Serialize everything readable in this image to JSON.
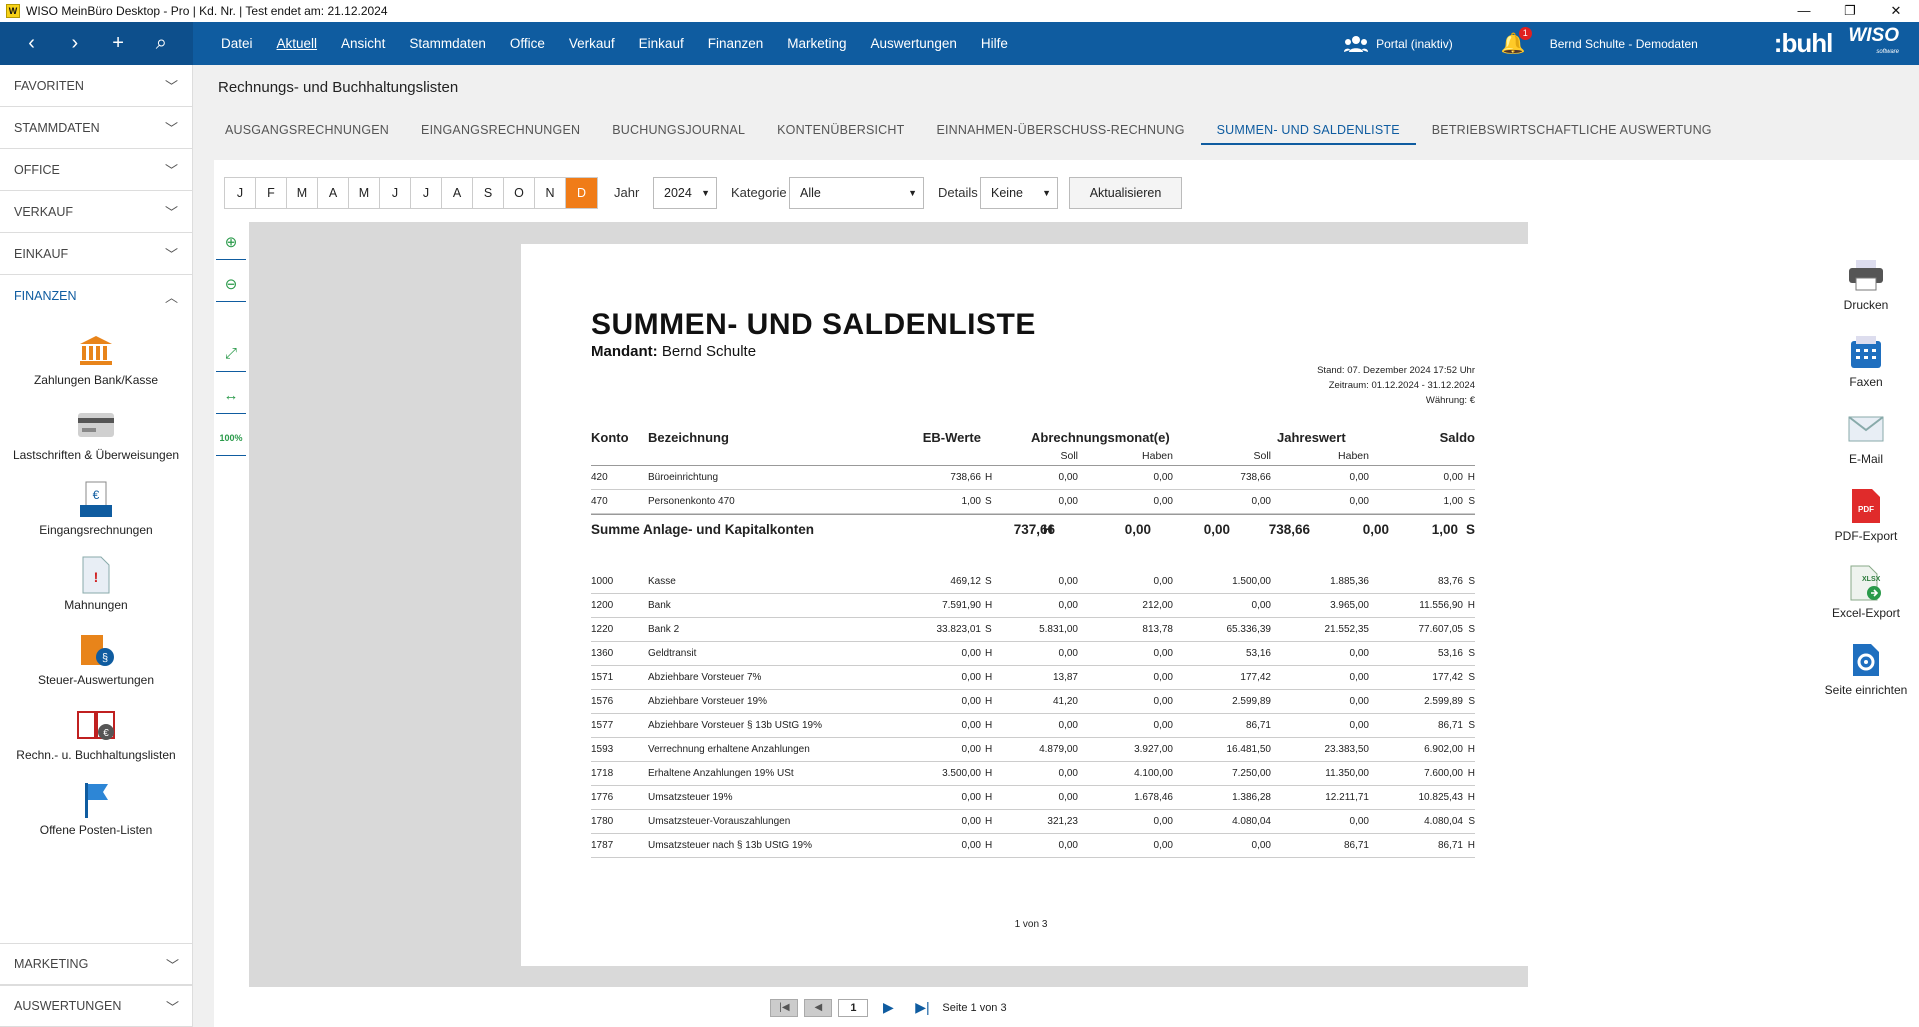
{
  "titlebar": {
    "text": "WISO MeinBüro Desktop - Pro | Kd. Nr.  | Test endet am: 21.12.2024",
    "minimize": "—",
    "maximize": "❐",
    "close": "✕"
  },
  "menubar": {
    "items": [
      "Datei",
      "Aktuell",
      "Ansicht",
      "Stammdaten",
      "Office",
      "Verkauf",
      "Einkauf",
      "Finanzen",
      "Marketing",
      "Auswertungen",
      "Hilfe"
    ],
    "portal": "Portal (inaktiv)",
    "notifications": "1",
    "user": "Bernd Schulte - Demodaten",
    "logo_buhl": ":buhl",
    "logo_wiso": "WISO",
    "logo_wiso_sub": "software"
  },
  "sidebar": {
    "sections": [
      "FAVORITEN",
      "STAMMDATEN",
      "OFFICE",
      "VERKAUF",
      "EINKAUF"
    ],
    "open_section": "FINANZEN",
    "links": [
      "Zahlungen Bank/Kasse",
      "Lastschriften & Überweisungen",
      "Eingangsrechnungen",
      "Mahnungen",
      "Steuer-Auswertungen",
      "Rechn.- u. Buchhaltungslisten",
      "Offene Posten-Listen"
    ],
    "bottom_sections": [
      "MARKETING",
      "AUSWERTUNGEN"
    ]
  },
  "page": {
    "title": "Rechnungs- und Buchhaltungslisten",
    "tabs": [
      "Ausgangsrechnungen",
      "Eingangsrechnungen",
      "Buchungsjournal",
      "Kontenübersicht",
      "Einnahmen-Überschuss-Rechnung",
      "Summen- und Saldenliste",
      "Betriebswirtschaftliche Auswertung"
    ],
    "active_tab": 5
  },
  "filters": {
    "months": [
      "J",
      "F",
      "M",
      "A",
      "M",
      "J",
      "J",
      "A",
      "S",
      "O",
      "N",
      "D"
    ],
    "selected_month": 11,
    "year_label": "Jahr",
    "year_value": "2024",
    "category_label": "Kategorie",
    "category_value": "Alle",
    "details_label": "Details",
    "details_value": "Keine",
    "refresh_label": "Aktualisieren"
  },
  "report": {
    "title": "SUMMEN- UND SALDENLISTE",
    "mandant_label": "Mandant:",
    "mandant_value": "Bernd Schulte",
    "stand": "Stand:  07. Dezember 2024 17:52 Uhr",
    "zeitraum": "Zeitraum: 01.12.2024 - 31.12.2024",
    "waehrung": "Währung: €",
    "headers": {
      "konto": "Konto",
      "bezeichnung": "Bezeichnung",
      "eb": "EB-Werte",
      "monat": "Abrechnungsmonat(e)",
      "jahr": "Jahreswert",
      "saldo": "Saldo"
    },
    "subheaders": {
      "soll": "Soll",
      "haben": "Haben"
    },
    "group1": [
      {
        "konto": "420",
        "bez": "Büroeinrichtung",
        "eb": "738,66",
        "ebs": "H",
        "ms": "0,00",
        "mh": "0,00",
        "js": "738,66",
        "jh": "0,00",
        "saldo": "0,00",
        "ss": "H"
      },
      {
        "konto": "470",
        "bez": "Personenkonto 470",
        "eb": "1,00",
        "ebs": "S",
        "ms": "0,00",
        "mh": "0,00",
        "js": "0,00",
        "jh": "0,00",
        "saldo": "1,00",
        "ss": "S"
      }
    ],
    "sum1": {
      "label": "Summe Anlage- und Kapitalkonten",
      "eb": "737,66",
      "ebs": "H",
      "ms": "0,00",
      "mh": "0,00",
      "js": "738,66",
      "jh": "0,00",
      "saldo": "1,00",
      "ss": "S"
    },
    "group2": [
      {
        "konto": "1000",
        "bez": "Kasse",
        "eb": "469,12",
        "ebs": "S",
        "ms": "0,00",
        "mh": "0,00",
        "js": "1.500,00",
        "jh": "1.885,36",
        "saldo": "83,76",
        "ss": "S"
      },
      {
        "konto": "1200",
        "bez": "Bank",
        "eb": "7.591,90",
        "ebs": "H",
        "ms": "0,00",
        "mh": "212,00",
        "js": "0,00",
        "jh": "3.965,00",
        "saldo": "11.556,90",
        "ss": "H"
      },
      {
        "konto": "1220",
        "bez": "Bank 2",
        "eb": "33.823,01",
        "ebs": "S",
        "ms": "5.831,00",
        "mh": "813,78",
        "js": "65.336,39",
        "jh": "21.552,35",
        "saldo": "77.607,05",
        "ss": "S"
      },
      {
        "konto": "1360",
        "bez": "Geldtransit",
        "eb": "0,00",
        "ebs": "H",
        "ms": "0,00",
        "mh": "0,00",
        "js": "53,16",
        "jh": "0,00",
        "saldo": "53,16",
        "ss": "S"
      },
      {
        "konto": "1571",
        "bez": "Abziehbare Vorsteuer 7%",
        "eb": "0,00",
        "ebs": "H",
        "ms": "13,87",
        "mh": "0,00",
        "js": "177,42",
        "jh": "0,00",
        "saldo": "177,42",
        "ss": "S"
      },
      {
        "konto": "1576",
        "bez": "Abziehbare Vorsteuer 19%",
        "eb": "0,00",
        "ebs": "H",
        "ms": "41,20",
        "mh": "0,00",
        "js": "2.599,89",
        "jh": "0,00",
        "saldo": "2.599,89",
        "ss": "S"
      },
      {
        "konto": "1577",
        "bez": "Abziehbare Vorsteuer § 13b UStG 19%",
        "eb": "0,00",
        "ebs": "H",
        "ms": "0,00",
        "mh": "0,00",
        "js": "86,71",
        "jh": "0,00",
        "saldo": "86,71",
        "ss": "S"
      },
      {
        "konto": "1593",
        "bez": "Verrechnung erhaltene Anzahlungen",
        "eb": "0,00",
        "ebs": "H",
        "ms": "4.879,00",
        "mh": "3.927,00",
        "js": "16.481,50",
        "jh": "23.383,50",
        "saldo": "6.902,00",
        "ss": "H"
      },
      {
        "konto": "1718",
        "bez": "Erhaltene Anzahlungen 19% USt",
        "eb": "3.500,00",
        "ebs": "H",
        "ms": "0,00",
        "mh": "4.100,00",
        "js": "7.250,00",
        "jh": "11.350,00",
        "saldo": "7.600,00",
        "ss": "H"
      },
      {
        "konto": "1776",
        "bez": "Umsatzsteuer 19%",
        "eb": "0,00",
        "ebs": "H",
        "ms": "0,00",
        "mh": "1.678,46",
        "js": "1.386,28",
        "jh": "12.211,71",
        "saldo": "10.825,43",
        "ss": "H"
      },
      {
        "konto": "1780",
        "bez": "Umsatzsteuer-Vorauszahlungen",
        "eb": "0,00",
        "ebs": "H",
        "ms": "321,23",
        "mh": "0,00",
        "js": "4.080,04",
        "jh": "0,00",
        "saldo": "4.080,04",
        "ss": "S"
      },
      {
        "konto": "1787",
        "bez": "Umsatzsteuer nach § 13b UStG 19%",
        "eb": "0,00",
        "ebs": "H",
        "ms": "0,00",
        "mh": "0,00",
        "js": "0,00",
        "jh": "86,71",
        "saldo": "86,71",
        "ss": "H"
      }
    ],
    "page_footer": "1 von 3"
  },
  "pager": {
    "current": "1",
    "text": "Seite 1 von 3"
  },
  "actions": [
    "Drucken",
    "Faxen",
    "E-Mail",
    "PDF-Export",
    "Excel-Export",
    "Seite einrichten"
  ],
  "colors": {
    "brand": "#0f5ca0",
    "accent": "#f07c18",
    "tool_green": "#2a9a4a"
  }
}
